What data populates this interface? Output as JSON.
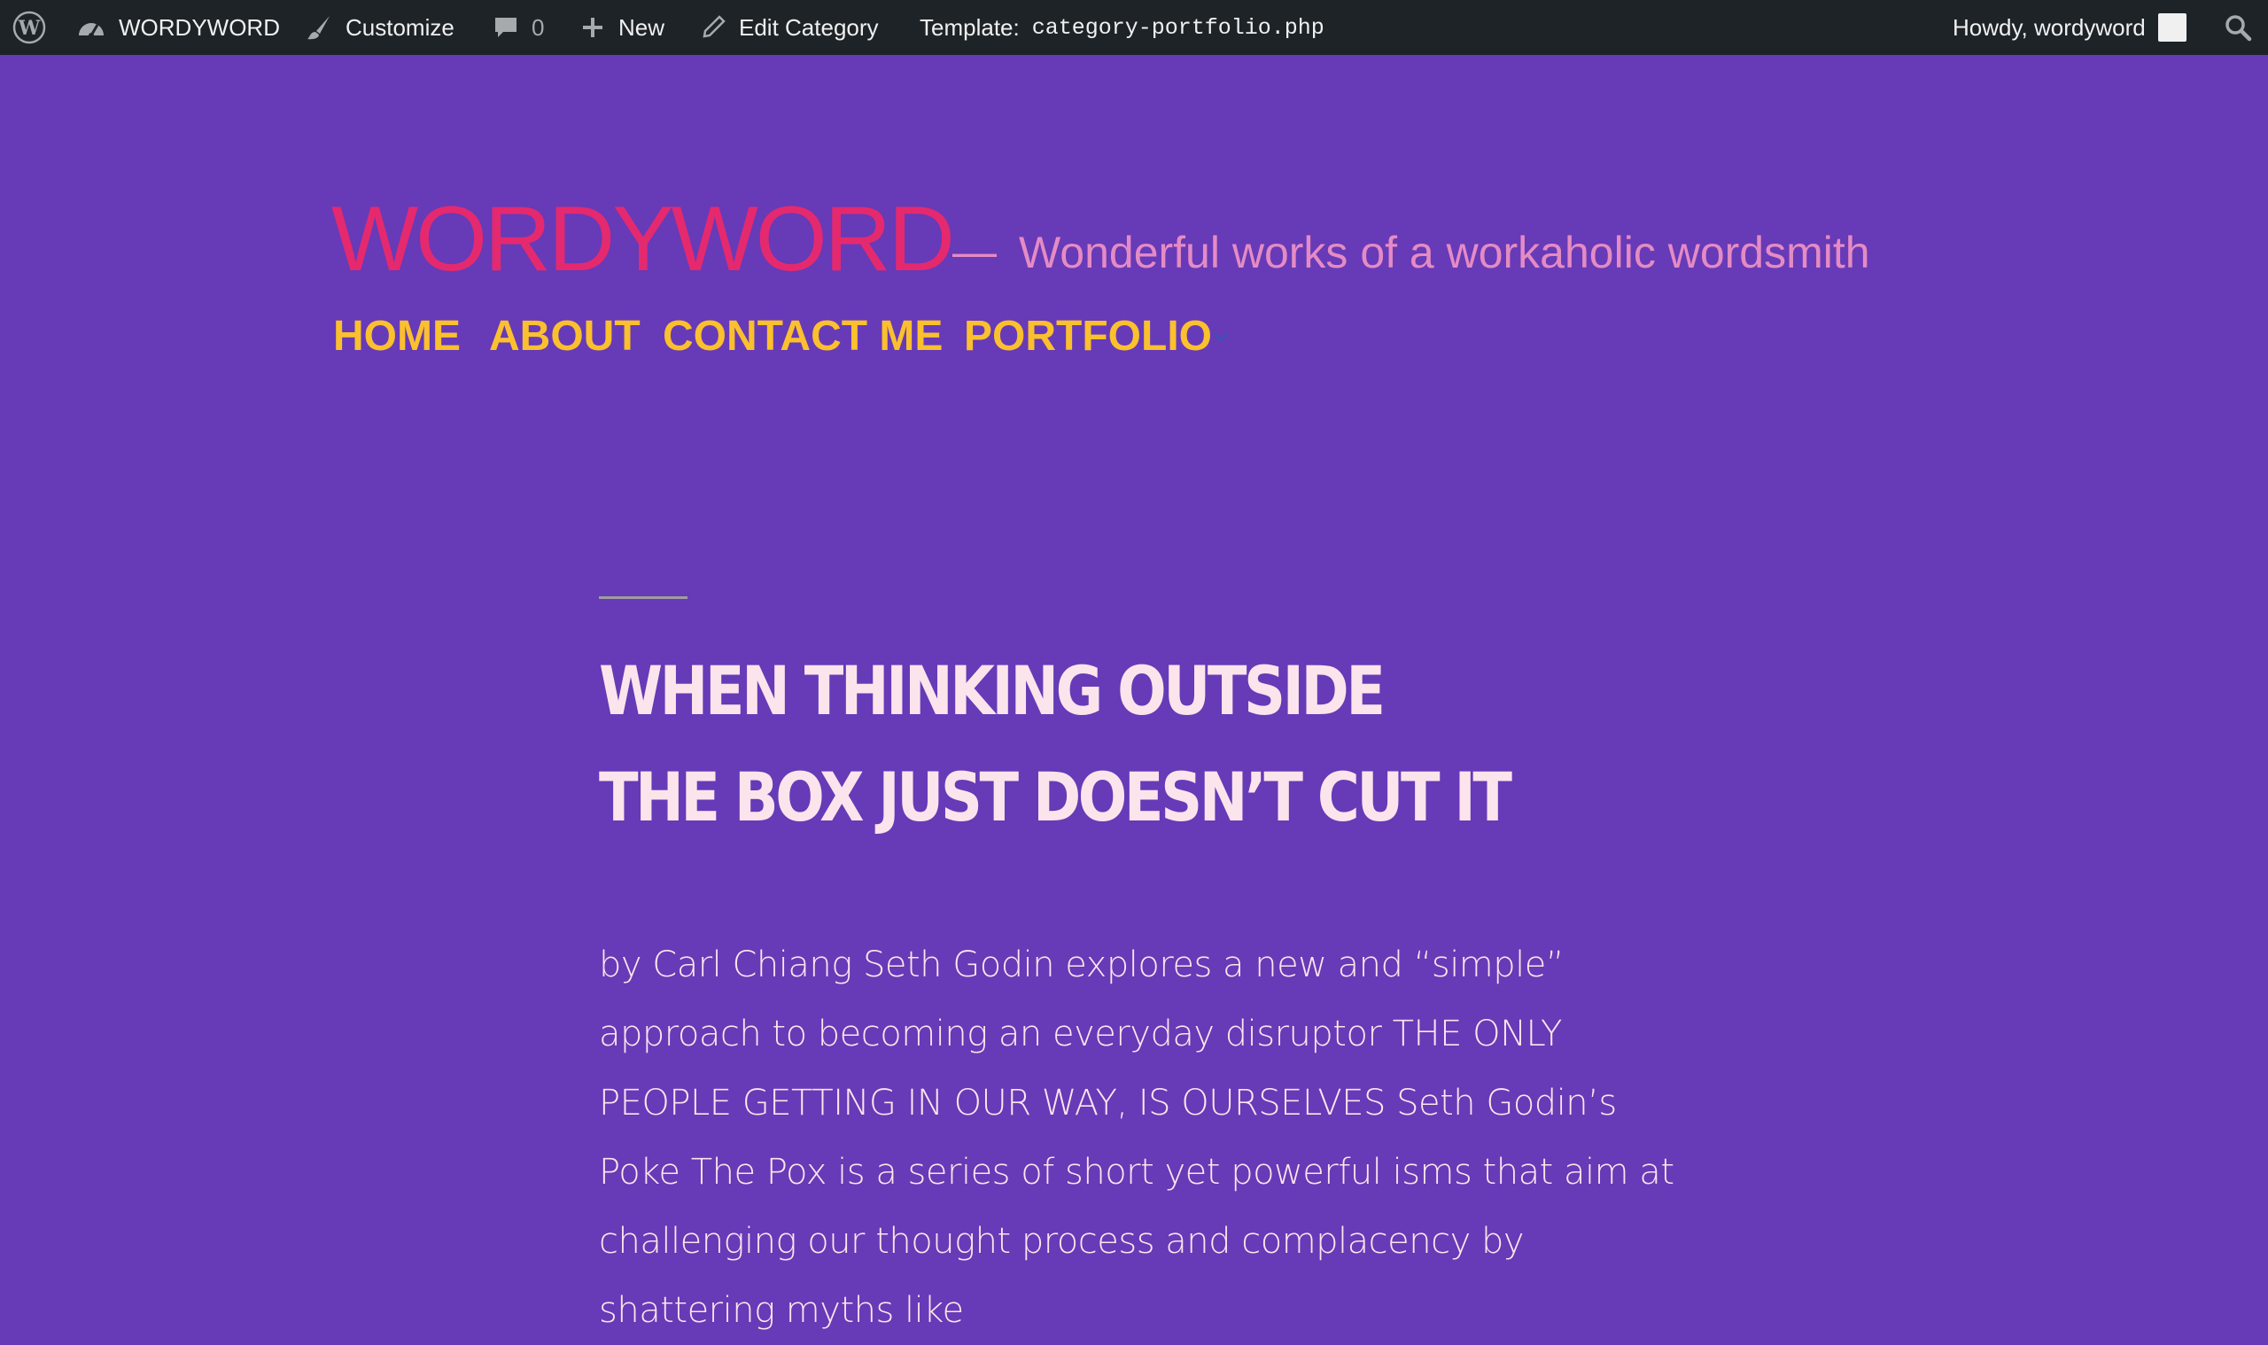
{
  "adminbar": {
    "site_name": "WORDYWORD",
    "customize": "Customize",
    "comments_count": "0",
    "new": "New",
    "edit_category": "Edit Category",
    "template_label": "Template:",
    "template_file": "category-portfolio.php",
    "howdy": "Howdy, wordyword"
  },
  "header": {
    "site_title": "WORDYWORD",
    "dash": "—",
    "tagline": "Wonderful works of a workaholic wordsmith"
  },
  "nav": {
    "items": [
      "HOME",
      "ABOUT",
      "CONTACT ME",
      "PORTFOLIO"
    ]
  },
  "post": {
    "title": "WHEN THINKING OUTSIDE THE BOX JUST DOESN’T CUT IT",
    "excerpt": "by Carl Chiang Seth Godin explores a new and “simple” approach to becoming an everyday disruptor THE ONLY PEOPLE GETTING IN OUR WAY, IS OURSELVES Seth Godin’s Poke The Pox is a series of short yet powerful isms that aim at challenging our thought process and complacency by shattering myths like"
  },
  "colors": {
    "background": "#673ab7",
    "admin_bar": "#1d2327",
    "site_title": "#e5296f",
    "tagline": "#e58bc4",
    "nav": "#fbc02d",
    "text": "#fce4ec"
  }
}
